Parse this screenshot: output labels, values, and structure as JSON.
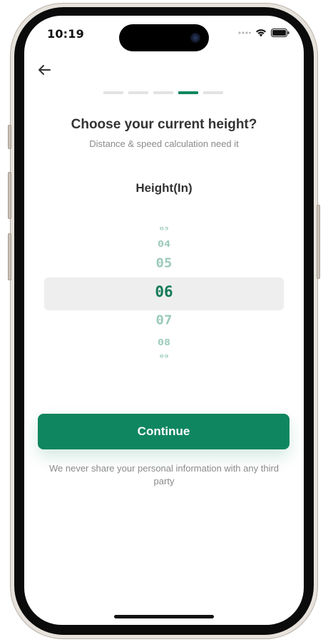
{
  "status_bar": {
    "time": "10:19",
    "signal": "cellular-dots-icon",
    "wifi": "wifi-icon",
    "battery": "battery-icon"
  },
  "nav": {
    "back_icon": "arrow-left-icon"
  },
  "progress": {
    "total_steps": 5,
    "current_step": 4
  },
  "header": {
    "title": "Choose your current height?",
    "subtitle": "Distance & speed calculation need it"
  },
  "picker": {
    "label": "Height(In)",
    "values": [
      "03",
      "04",
      "05",
      "06",
      "07",
      "08",
      "09"
    ],
    "selected": "06"
  },
  "actions": {
    "continue_label": "Continue"
  },
  "footer": {
    "privacy_note": "We never share your personal information with any third party"
  },
  "colors": {
    "accent": "#0f8660",
    "picker_faded": "#9ccbb9",
    "picker_selected": "#157a58",
    "highlight_bg": "#eeeeee",
    "muted_text": "#8a8a8a"
  }
}
